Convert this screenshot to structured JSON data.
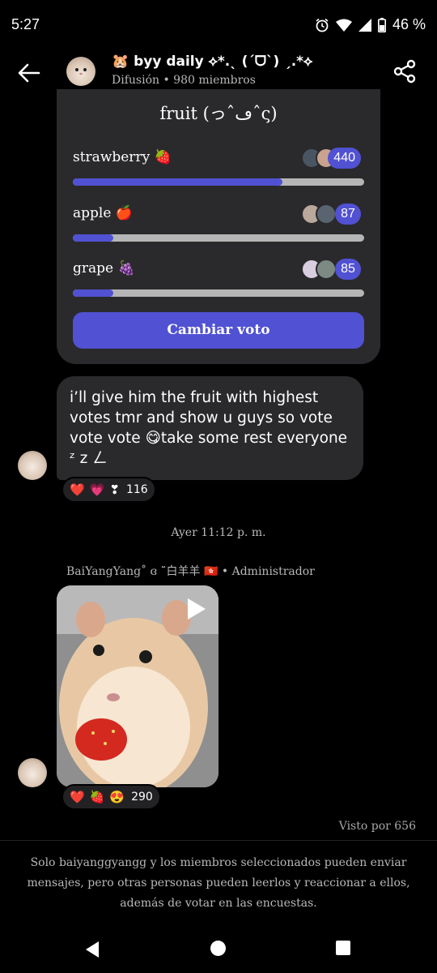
{
  "status_bar": {
    "time": "5:27",
    "battery": "46 %",
    "icons": [
      "alarm-icon",
      "wifi-icon",
      "signal-icon",
      "battery-icon"
    ]
  },
  "header": {
    "title": "🐹 byy daily ⟡*.ˎ (ˊᗜˋ) ˏ.*⟡",
    "subtitle": "Difusión • 980 miembros"
  },
  "poll": {
    "title": "fruit (っˆڡˆς)",
    "options": [
      {
        "label": "strawberry 🍓",
        "count": "440",
        "fraction": 0.72
      },
      {
        "label": "apple 🍎",
        "count": "87",
        "fraction": 0.14
      },
      {
        "label": "grape 🍇",
        "count": "85",
        "fraction": 0.14
      }
    ],
    "button_label": "Cambiar voto"
  },
  "message": {
    "text": "i’ll give him the fruit with highest votes tmr and show u guys so vote vote vote 😋take some rest everyone ᶻ z ㄥ",
    "reactions": [
      "❤️",
      "💗",
      "❣"
    ],
    "reaction_count": "116"
  },
  "timestamp": "Ayer 11:12 p. m.",
  "sender": "BaiYangYang˚ ɞ ˘̈白羊羊 🇭🇰 • Administrador",
  "photo_message": {
    "reactions": [
      "❤️",
      "🍓",
      "😍"
    ],
    "reaction_count": "290"
  },
  "seen_by": "Visto por 656",
  "footer_notice": "Solo baiyanggyangg y los miembros seleccionados pueden enviar mensajes, pero otras personas pueden leerlos y reaccionar a ellos, además de votar en las encuestas.",
  "colors": {
    "accent": "#5151d3",
    "bubble": "#2a2a2c",
    "background": "#000000"
  }
}
